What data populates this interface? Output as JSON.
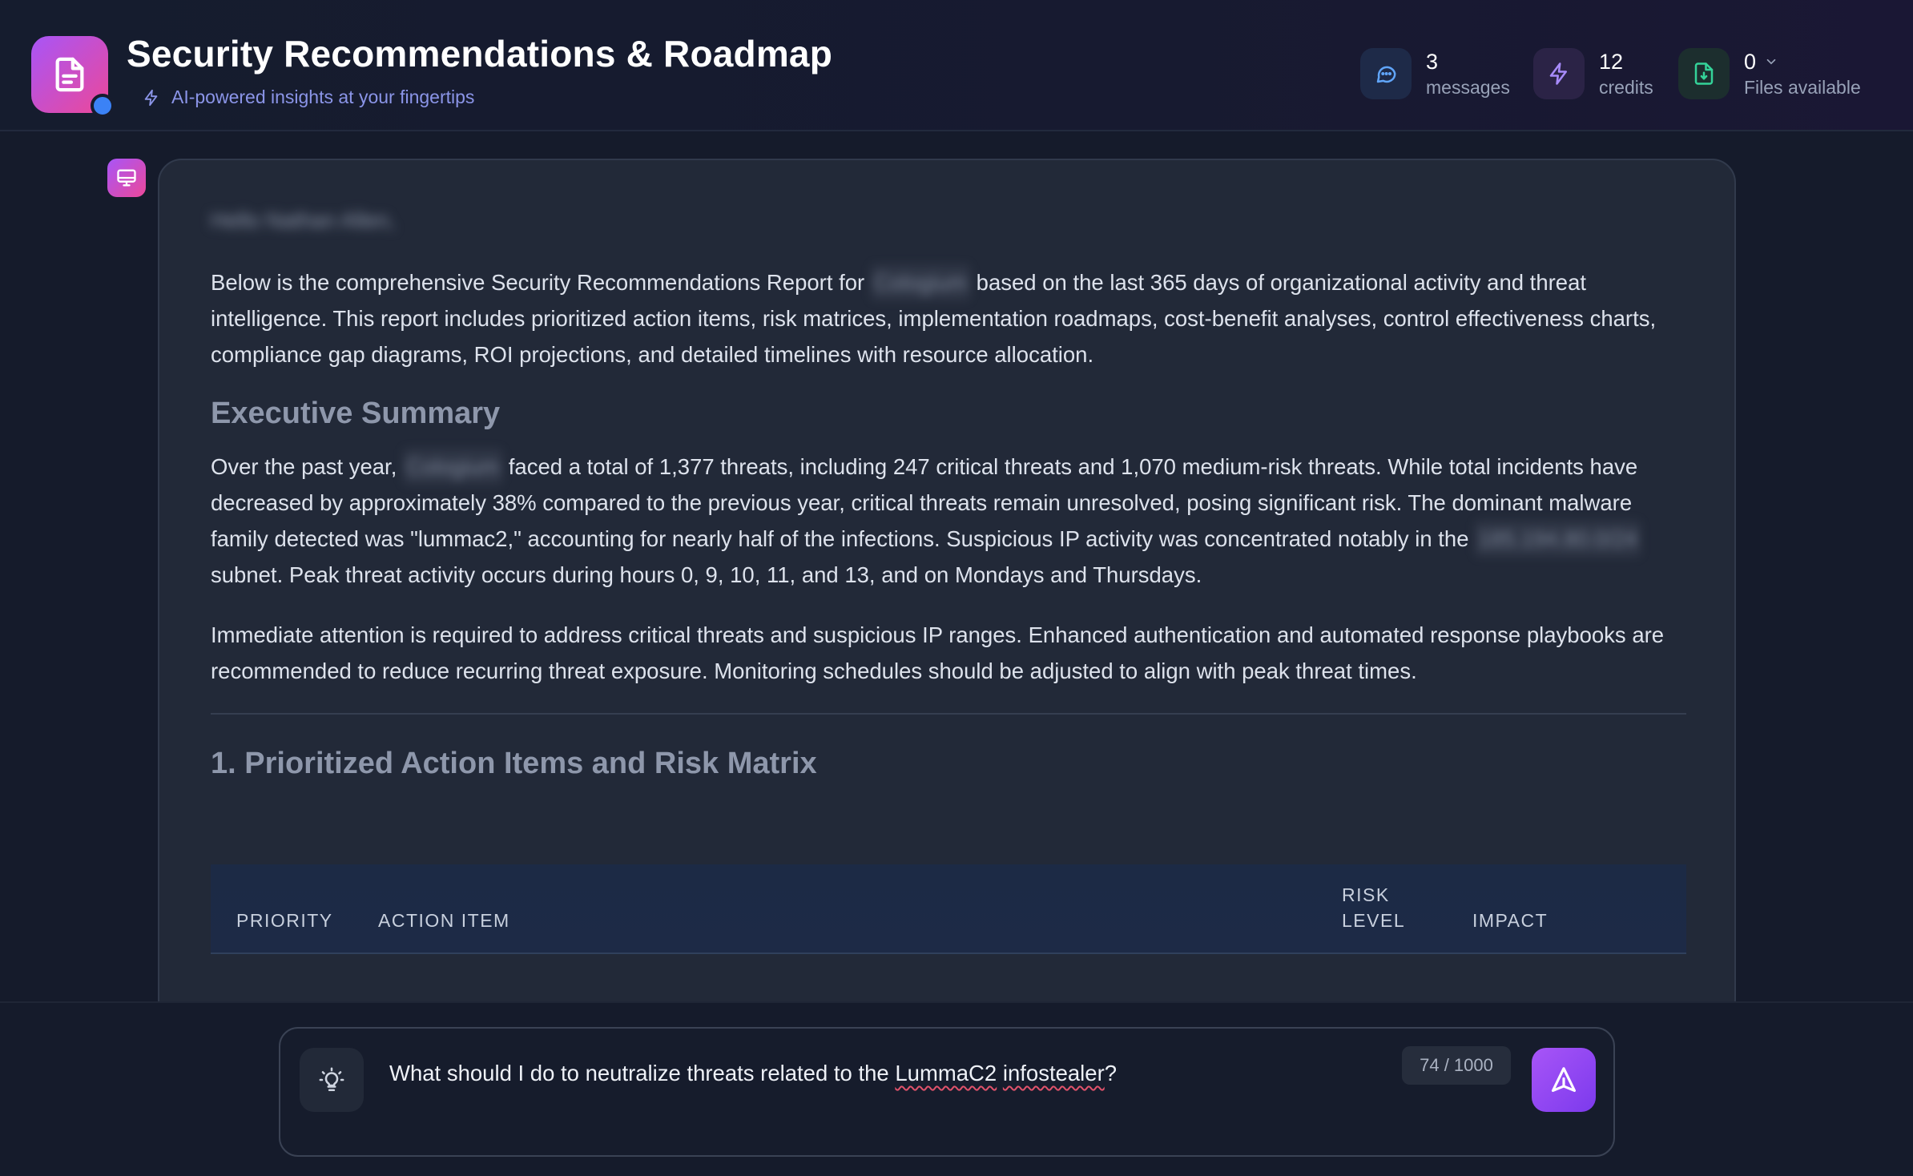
{
  "header": {
    "title": "Security Recommendations & Roadmap",
    "subtitle": "AI-powered insights at your fingertips",
    "logo_icon": "document-icon",
    "stats": [
      {
        "value": "3",
        "label": "messages",
        "icon": "chat-bubble-icon",
        "color": "#60a5fa"
      },
      {
        "value": "12",
        "label": "credits",
        "icon": "lightning-icon",
        "color": "#a78bfa"
      },
      {
        "value": "0",
        "label": "Files available",
        "icon": "file-download-icon",
        "color": "#34d399"
      }
    ]
  },
  "message": {
    "greeting": "Hello Nathan Allen,",
    "intro_before": "Below is the comprehensive Security Recommendations Report for ",
    "intro_redacted": "Cologium",
    "intro_after": " based on the last 365 days of organizational activity and threat intelligence. This report includes prioritized action items, risk matrices, implementation roadmaps, cost-benefit analyses, control effectiveness charts, compliance gap diagrams, ROI projections, and detailed timelines with resource allocation.",
    "exec_heading": "Executive Summary",
    "exec_p1_a": "Over the past year, ",
    "exec_p1_redacted_org": "Cologium",
    "exec_p1_b": " faced a total of 1,377 threats, including 247 critical threats and 1,070 medium-risk threats. While total incidents have decreased by approximately 38% compared to the previous year, critical threats remain unresolved, posing significant risk. The dominant malware family detected was \"lummac2,\" accounting for nearly half of the infections. Suspicious IP activity was concentrated notably in the ",
    "exec_p1_redacted_subnet": "185.194.80.0/24",
    "exec_p1_c": " subnet. Peak threat activity occurs during hours 0, 9, 10, 11, and 13, and on Mondays and Thursdays.",
    "exec_p2": "Immediate attention is required to address critical threats and suspicious IP ranges. Enhanced authentication and automated response playbooks are recommended to reduce recurring threat exposure. Monitoring schedules should be adjusted to align with peak threat times.",
    "section1_heading": "1. Prioritized Action Items and Risk Matrix",
    "table_headers": {
      "priority": "PRIORITY",
      "action_item": "ACTION ITEM",
      "risk_level_1": "RISK",
      "risk_level_2": "LEVEL",
      "impact": "IMPACT"
    }
  },
  "input": {
    "value_before": "What should I do to neutralize threats related to the ",
    "value_misspelled_1": "LummaC2",
    "value_space": " ",
    "value_misspelled_2": "infostealer",
    "value_after": "?",
    "counter": "74 / 1000",
    "idea_icon": "lightbulb-icon",
    "send_icon": "send-icon"
  }
}
